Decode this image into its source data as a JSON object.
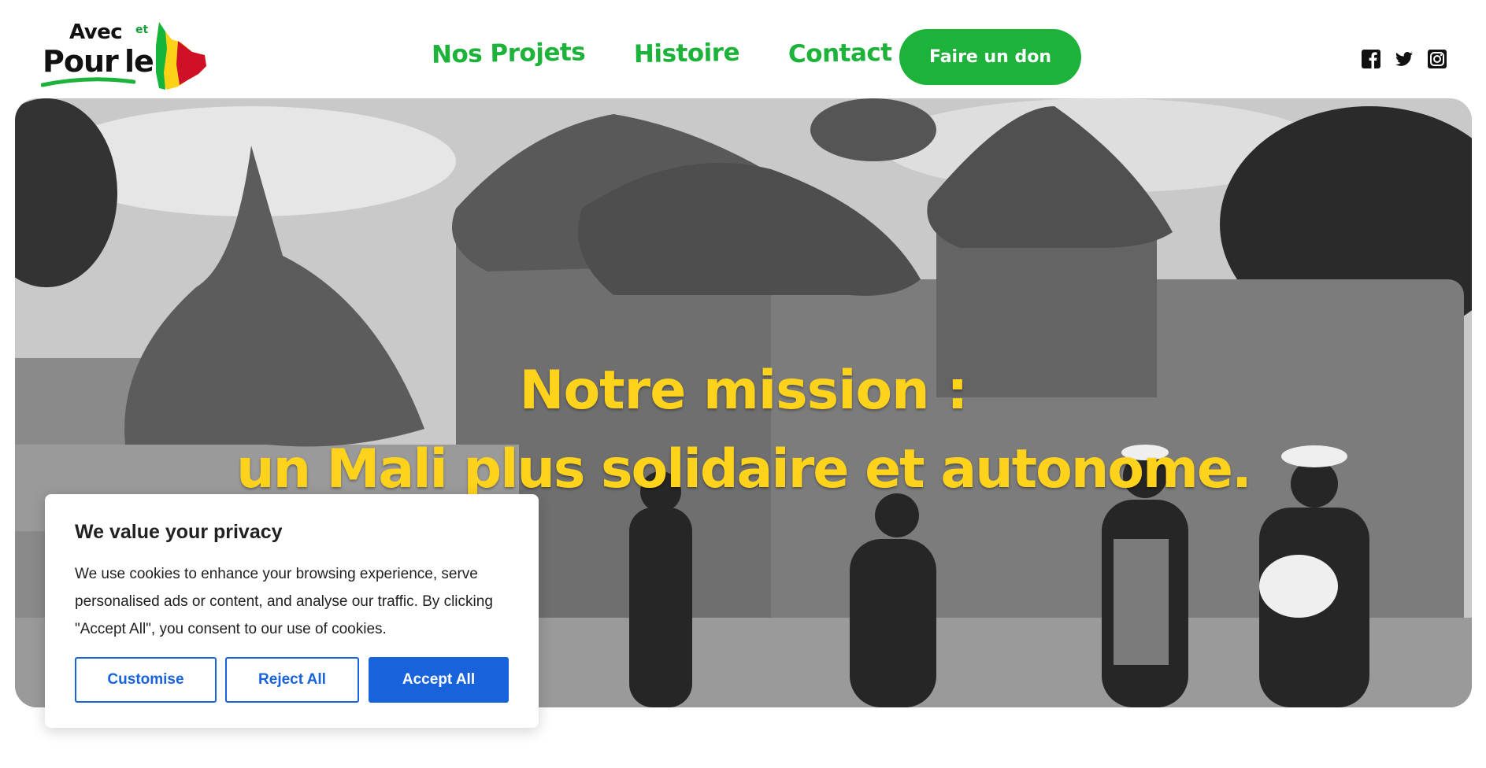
{
  "logo": {
    "word_avec": "Avec",
    "word_et": "et",
    "word_pour": "Pour",
    "word_le": "le"
  },
  "nav": {
    "items": [
      {
        "label": "Nos Projets"
      },
      {
        "label": "Histoire"
      },
      {
        "label": "Contact"
      }
    ],
    "donate_label": "Faire un don"
  },
  "social": {
    "icons": [
      "facebook-icon",
      "twitter-icon",
      "instagram-icon"
    ]
  },
  "hero": {
    "line1": "Notre mission  :",
    "line2": "un Mali plus solidaire et autonome."
  },
  "cookie_banner": {
    "title": "We value your privacy",
    "text": "We use cookies to enhance your browsing experience, serve personalised ads or content, and analyse our traffic. By clicking \"Accept All\", you consent to our use of cookies.",
    "customise_label": "Customise",
    "reject_label": "Reject All",
    "accept_label": "Accept All"
  },
  "colors": {
    "brand_green": "#1db23a",
    "headline_yellow": "#ffd21b",
    "cookie_blue": "#1863dc",
    "mali_red": "#ce1126",
    "mali_yellow": "#fcd116"
  }
}
